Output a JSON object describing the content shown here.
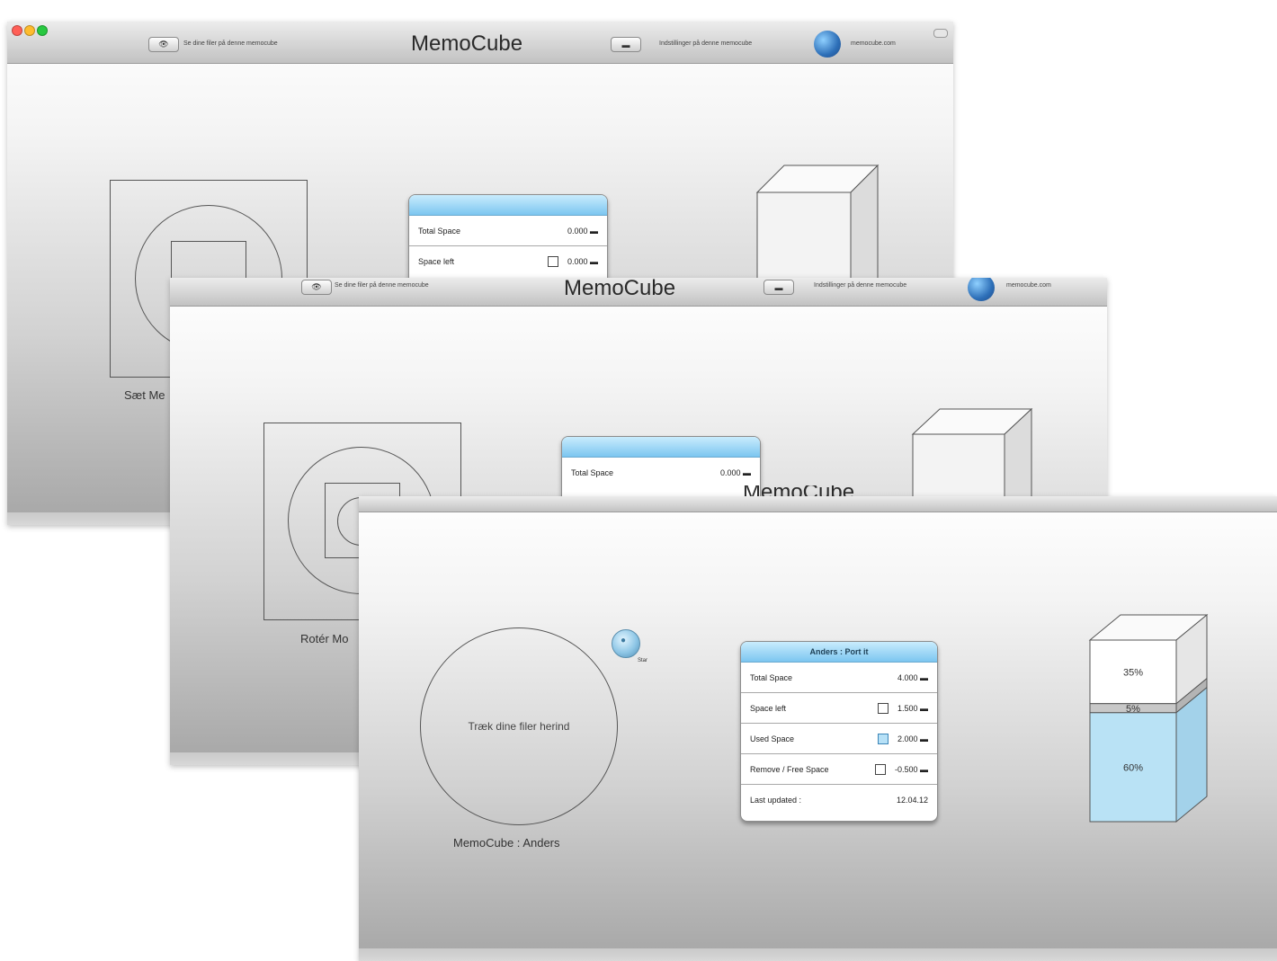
{
  "app": {
    "title": "MemoCube",
    "left_button_text": "Se dine filer på denne memocube",
    "right_button_text": "Indstillinger på denne memocube",
    "link_text": "memocube.com",
    "eye_glyph": "👁",
    "battery_glyph": "▬"
  },
  "window_back": {
    "panel": {
      "rows": [
        {
          "label": "Total Space",
          "value": "0.000 ▬"
        },
        {
          "label": "Space left",
          "value": "0.000 ▬"
        }
      ]
    },
    "caption": "Sæt Me"
  },
  "window_middle": {
    "left_button_text": "Se dine filer på denne memocube",
    "panel": {
      "rows": [
        {
          "label": "Total Space",
          "value": "0.000 ▬"
        }
      ]
    },
    "caption": "Rotér Mo"
  },
  "window_front": {
    "circle_text": "Træk dine filer herind",
    "caption": "MemoCube : Anders",
    "star_label": "Star",
    "panel": {
      "title": "Anders : Port it",
      "rows": [
        {
          "label": "Total Space",
          "value": "4.000 ▬",
          "checkbox": "none"
        },
        {
          "label": "Space left",
          "value": "1.500 ▬",
          "checkbox": "white"
        },
        {
          "label": "Used Space",
          "value": "2.000 ▬",
          "checkbox": "blue"
        },
        {
          "label": "Remove / Free Space",
          "value": "-0.500 ▬",
          "checkbox": "white"
        },
        {
          "label": "Last updated :",
          "value": "12.04.12",
          "checkbox": "none"
        }
      ]
    },
    "cube": {
      "segments": [
        {
          "label": "35%",
          "fraction": 0.35,
          "color": "#ffffff"
        },
        {
          "label": "5%",
          "fraction": 0.05,
          "color": "#c8c8c8"
        },
        {
          "label": "60%",
          "fraction": 0.6,
          "color": "#b9e2f5"
        }
      ]
    }
  },
  "colors": {
    "accent": "#7cc6f0",
    "close": "#ff5f57",
    "minimize": "#febc2e",
    "zoom": "#28c840"
  }
}
